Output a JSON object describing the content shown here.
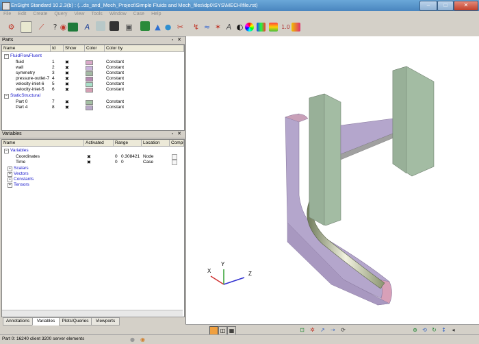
{
  "window": {
    "title": "EnSight Standard 10.2.3(b) : (...ds_and_Mech_Project\\Simple Fluids and Mech_files\\dp0\\SYS\\MECH\\file.rst)"
  },
  "menu": [
    "File",
    "Edit",
    "Create",
    "Query",
    "View",
    "Tools",
    "Window",
    "Case",
    "Help"
  ],
  "toolbar_icons": [
    "open-icon",
    "table-icon",
    "graph-icon",
    "query-icon",
    "record-icon",
    "frame-icon",
    "text-annotation-icon",
    "surface-icon",
    "clip-icon",
    "camera-icon",
    "case-icon",
    "elevate-icon",
    "isosurface-icon",
    "particle-trace-icon",
    "cut-icon",
    "streamline-icon",
    "vortex-icon",
    "annotation-a-icon",
    "eye-icon",
    "color-wheel-icon",
    "legend-icon",
    "palette-icon",
    "range-icon",
    "scale-icon"
  ],
  "parts_panel": {
    "title": "Parts",
    "columns": [
      "Name",
      "Id",
      "Show",
      "Color",
      "Color by"
    ],
    "groups": [
      {
        "name": "FluidFlowFluent",
        "parts": [
          {
            "name": "fluid",
            "id": "1",
            "show": "✖",
            "color": "#d8a8c8",
            "colorby": "Constant"
          },
          {
            "name": "wall",
            "id": "2",
            "show": "✖",
            "color": "#c9b4dc",
            "colorby": "Constant"
          },
          {
            "name": "symmetry",
            "id": "3",
            "show": "✖",
            "color": "#a3b9a3",
            "colorby": "Constant"
          },
          {
            "name": "pressure-outlet-7",
            "id": "4",
            "show": "✖",
            "color": "#b48ab0",
            "colorby": "Constant"
          },
          {
            "name": "velocity-inlet-6",
            "id": "5",
            "show": "✖",
            "color": "#a8e0c8",
            "colorby": "Constant"
          },
          {
            "name": "velocity-inlet-5",
            "id": "6",
            "show": "✖",
            "color": "#d4a0b4",
            "colorby": "Constant"
          }
        ]
      },
      {
        "name": "StaticStructural",
        "parts": [
          {
            "name": "Part 0",
            "id": "7",
            "show": "✖",
            "color": "#a3bfa3",
            "colorby": "Constant"
          },
          {
            "name": "Part 4",
            "id": "8",
            "show": "✖",
            "color": "#b8a8c8",
            "colorby": "Constant"
          }
        ]
      }
    ]
  },
  "variables_panel": {
    "title": "Variables",
    "columns": [
      "Name",
      "Activated",
      "Range",
      "Location",
      "Compu"
    ],
    "root": "Variables",
    "items": [
      {
        "name": "Coordinates",
        "activated": "✖",
        "range_min": "0",
        "range_max": "0.308421",
        "location": "Node"
      },
      {
        "name": "Time",
        "activated": "✖",
        "range_min": "0",
        "range_max": "0",
        "location": "Case"
      }
    ],
    "groups": [
      "Scalars",
      "Vectors",
      "Constants",
      "Tensors"
    ]
  },
  "bottom_tabs": [
    "Annotations",
    "Variables",
    "Plots/Queries",
    "Viewports"
  ],
  "selected_tab": "Variables",
  "status": "Part 0: 16240 client 3200 server elements",
  "axis": {
    "x": "X",
    "y": "Y",
    "z": "Z"
  },
  "colors": {
    "green": "#a3bca3",
    "purple": "#b4a6cc",
    "pink": "#c8a0b8"
  }
}
